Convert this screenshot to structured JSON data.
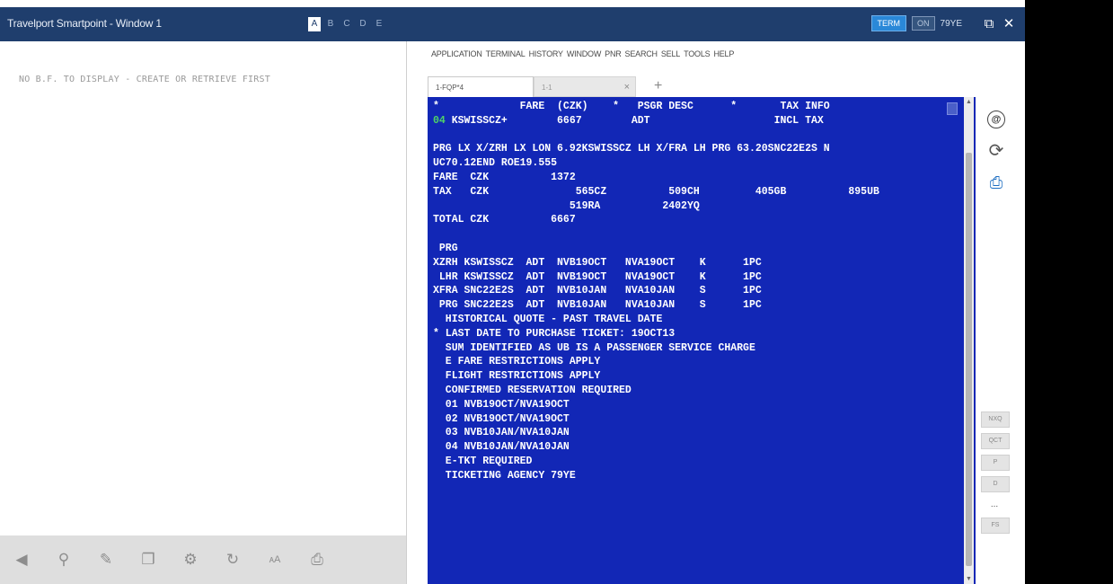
{
  "window": {
    "title": "Travelport Smartpoint - Window 1"
  },
  "workspace_tabs": [
    "A",
    "B",
    "C",
    "D",
    "E"
  ],
  "titlebar_right": {
    "mode": "TERM",
    "toggle": "ON",
    "pcc": "79YE"
  },
  "left_panel": {
    "message": "NO B.F. TO DISPLAY - CREATE OR RETRIEVE FIRST"
  },
  "menu": [
    "APPLICATION",
    "TERMINAL",
    "HISTORY",
    "WINDOW",
    "PNR",
    "SEARCH",
    "SELL",
    "TOOLS",
    "HELP"
  ],
  "terminal_tabs": [
    {
      "label": "1-FQP*4"
    },
    {
      "label": "1-1"
    }
  ],
  "terminal": {
    "lines": [
      "*             FARE  (CZK)    *   PSGR DESC      *       TAX INFO",
      "[[04]] KSWISSCZ+        6667        ADT                    INCL TAX",
      "",
      "PRG LX X/ZRH LX LON 6.92KSWISSCZ LH X/FRA LH PRG 63.20SNC22E2S N",
      "UC70.12END ROE19.555",
      "FARE  CZK          1372",
      "TAX   CZK              565CZ          509CH         405GB          895UB",
      "                      519RA          2402YQ",
      "TOTAL CZK          6667",
      "",
      " PRG",
      "XZRH KSWISSCZ  ADT  NVB19OCT   NVA19OCT    K      1PC",
      " LHR KSWISSCZ  ADT  NVB19OCT   NVA19OCT    K      1PC",
      "XFRA SNC22E2S  ADT  NVB10JAN   NVA10JAN    S      1PC",
      " PRG SNC22E2S  ADT  NVB10JAN   NVA10JAN    S      1PC",
      "  HISTORICAL QUOTE - PAST TRAVEL DATE",
      "* LAST DATE TO PURCHASE TICKET: 19OCT13",
      "  SUM IDENTIFIED AS UB IS A PASSENGER SERVICE CHARGE",
      "  E FARE RESTRICTIONS APPLY",
      "  FLIGHT RESTRICTIONS APPLY",
      "  CONFIRMED RESERVATION REQUIRED",
      "  01 NVB19OCT/NVA19OCT",
      "  02 NVB19OCT/NVA19OCT",
      "  03 NVB10JAN/NVA10JAN",
      "  04 NVB10JAN/NVA10JAN",
      "  E-TKT REQUIRED",
      "  TICKETING AGENCY 79YE"
    ]
  },
  "quick_buttons": [
    "NXQ",
    "QCT",
    "P",
    "D",
    "...",
    "FS"
  ],
  "icons": {
    "left_toolbar": [
      "send-icon",
      "search-icon",
      "pencil-icon",
      "copy-icon",
      "gear-icon",
      "refresh-icon",
      "font-size-icon",
      "print-icon"
    ],
    "side": [
      "at-sign-icon",
      "refresh-icon",
      "print-icon"
    ]
  },
  "colors": {
    "terminal_bg": "#1227b6",
    "titlebar_bg": "#1f3e6d",
    "highlight": "#4fd466"
  }
}
